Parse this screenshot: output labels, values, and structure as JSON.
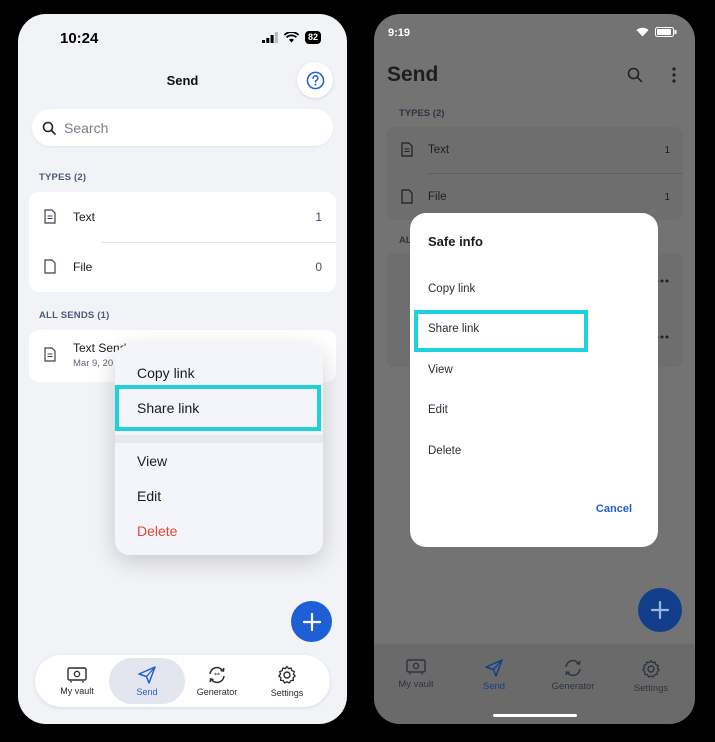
{
  "ios": {
    "status": {
      "time": "10:24",
      "battery": "82"
    },
    "title": "Send",
    "help_icon": "question-circle-icon",
    "search": {
      "placeholder": "Search"
    },
    "types_label": "TYPES (2)",
    "types": [
      {
        "label": "Text",
        "count": "1",
        "icon": "text-doc-icon"
      },
      {
        "label": "File",
        "count": "0",
        "icon": "file-icon"
      }
    ],
    "all_sends_label": "ALL SENDS (1)",
    "sends": [
      {
        "name": "Text Send",
        "date": "Mar 9, 20"
      }
    ],
    "menu": {
      "copy_link": "Copy link",
      "share_link": "Share link",
      "view": "View",
      "edit": "Edit",
      "delete": "Delete"
    },
    "tabs": [
      {
        "label": "My vault",
        "icon": "vault-icon"
      },
      {
        "label": "Send",
        "icon": "send-icon"
      },
      {
        "label": "Generator",
        "icon": "generator-icon"
      },
      {
        "label": "Settings",
        "icon": "gear-icon"
      }
    ],
    "active_tab": "Send",
    "colors": {
      "accent": "#1f5fd6",
      "danger": "#e0453a",
      "highlight": "#1fd1de"
    }
  },
  "android": {
    "status": {
      "time": "9:19"
    },
    "title": "Send",
    "types_label": "TYPES (2)",
    "types": [
      {
        "label": "Text",
        "count": "1"
      },
      {
        "label": "File",
        "count": "1"
      }
    ],
    "all_sends_label_partial": "AL",
    "dialog": {
      "title": "Safe info",
      "items": {
        "copy_link": "Copy link",
        "share_link": "Share link",
        "view": "View",
        "edit": "Edit",
        "delete": "Delete"
      },
      "cancel": "Cancel"
    },
    "tabs": [
      {
        "label": "My vault"
      },
      {
        "label": "Send"
      },
      {
        "label": "Generator"
      },
      {
        "label": "Settings"
      }
    ],
    "active_tab": "Send"
  }
}
